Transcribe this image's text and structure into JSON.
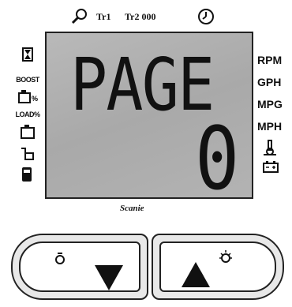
{
  "top": {
    "trip1_label": "Tr1",
    "trip2_label": "Tr2 000",
    "icons": [
      "magnifier-icon",
      "clock-icon"
    ]
  },
  "display": {
    "line1": "PAGE",
    "line2": "0"
  },
  "left_indicators": {
    "boost": "BOOST",
    "percent": "%",
    "load": "LOAD%"
  },
  "right_indicators": {
    "rpm": "RPM",
    "gph": "GPH",
    "mpg": "MPG",
    "mph": "MPH"
  },
  "brand": "Scanie",
  "buttons": {
    "down_label": "down",
    "up_label": "up"
  },
  "colors": {
    "lcd_background": "#b0b0b0",
    "segment": "#111111",
    "button_fill": "#e8e8e8"
  }
}
